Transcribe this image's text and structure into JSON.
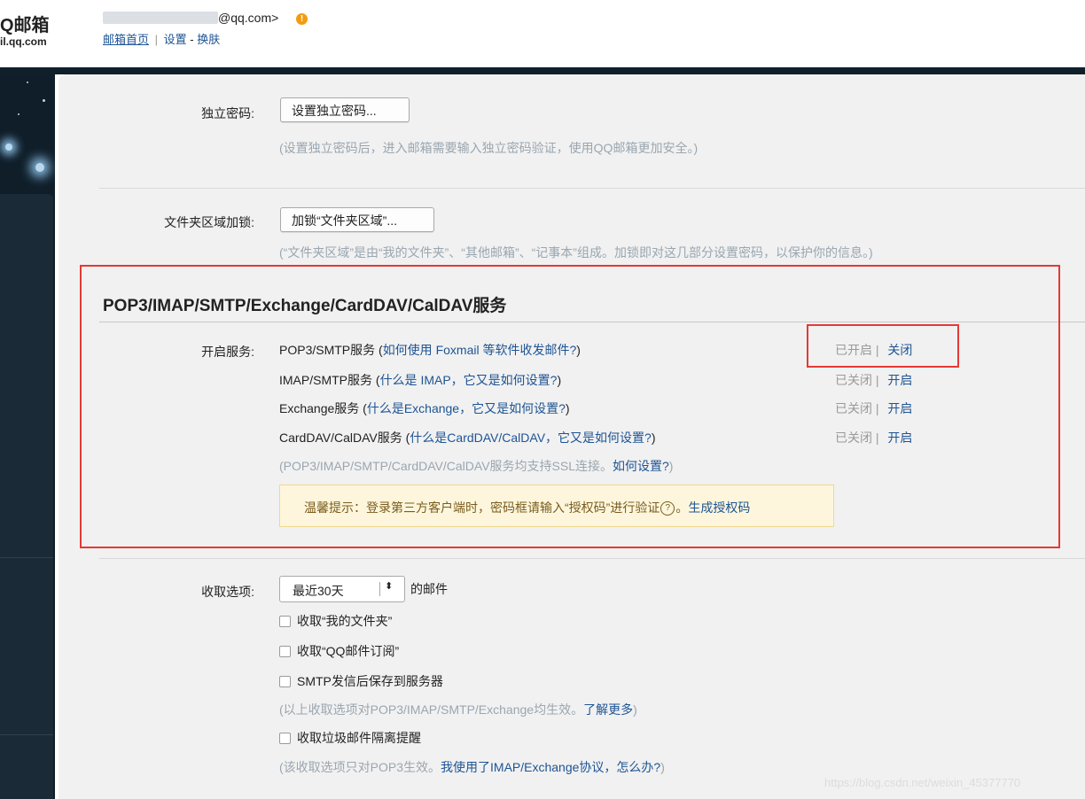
{
  "header": {
    "logo_main": "Q邮箱",
    "logo_sub": "il.qq.com",
    "email_suffix": "@qq.com>",
    "warn_glyph": "!",
    "nav_home": "邮箱首页",
    "nav_sep": "|",
    "nav_settings": "设置",
    "nav_dash": "-",
    "nav_skin": "换肤"
  },
  "security": {
    "pwd_label": "独立密码:",
    "pwd_button": "设置独立密码...",
    "pwd_hint": "(设置独立密码后，进入邮箱需要输入独立密码验证，使用QQ邮箱更加安全。)",
    "lock_label": "文件夹区域加锁:",
    "lock_button": "加锁“文件夹区域”...",
    "lock_hint": "(“文件夹区域”是由“我的文件夹”、“其他邮箱”、“记事本”组成。加锁即对这几部分设置密码，以保护你的信息。)"
  },
  "services": {
    "section_title": "POP3/IMAP/SMTP/Exchange/CardDAV/CalDAV服务",
    "enable_label": "开启服务:",
    "rows": [
      {
        "name": "POP3/SMTP服务 (",
        "link": "如何使用 Foxmail 等软件收发邮件?",
        "close": ")",
        "status": "已开启",
        "sep": "|",
        "action": "关闭"
      },
      {
        "name": "IMAP/SMTP服务 (",
        "link": "什么是 IMAP，它又是如何设置?",
        "close": ")",
        "status": "已关闭",
        "sep": "|",
        "action": "开启"
      },
      {
        "name": "Exchange服务 (",
        "link": "什么是Exchange，它又是如何设置?",
        "close": ")",
        "status": "已关闭",
        "sep": "|",
        "action": "开启"
      },
      {
        "name": "CardDAV/CalDAV服务 (",
        "link": "什么是CardDAV/CalDAV，它又是如何设置?",
        "close": ")",
        "status": "已关闭",
        "sep": "|",
        "action": "开启"
      }
    ],
    "ssl_note_pre": "(POP3/IMAP/SMTP/CardDAV/CalDAV服务均支持SSL连接。",
    "ssl_note_link": "如何设置?",
    "ssl_note_post": ")",
    "tip_pre": "温馨提示：登录第三方客户端时，密码框请输入“授权码”进行验证",
    "tip_icon": "?",
    "tip_mid": "。",
    "tip_link": "生成授权码"
  },
  "receive": {
    "label": "收取选项:",
    "range_value": "最近30天",
    "range_arrow": "⬍",
    "range_suffix": "的邮件",
    "options": [
      "收取“我的文件夹”",
      "收取“QQ邮件订阅”",
      "SMTP发信后保存到服务器"
    ],
    "note1_pre": "(以上收取选项对POP3/IMAP/SMTP/Exchange均生效。",
    "note1_link": "了解更多",
    "note1_post": ")",
    "spam_option": "收取垃圾邮件隔离提醒",
    "note2_pre": "(该收取选项只对POP3生效。",
    "note2_link": "我使用了IMAP/Exchange协议，怎么办?",
    "note2_post": ")"
  },
  "watermark": "https://blog.csdn.net/weixin_45377770",
  "colors": {
    "link": "#1e5494",
    "highlight_border": "#e53935",
    "sidebar": "#0f1e29",
    "content_bg": "#f1f1f1",
    "tip_bg": "#fdf6dc"
  }
}
